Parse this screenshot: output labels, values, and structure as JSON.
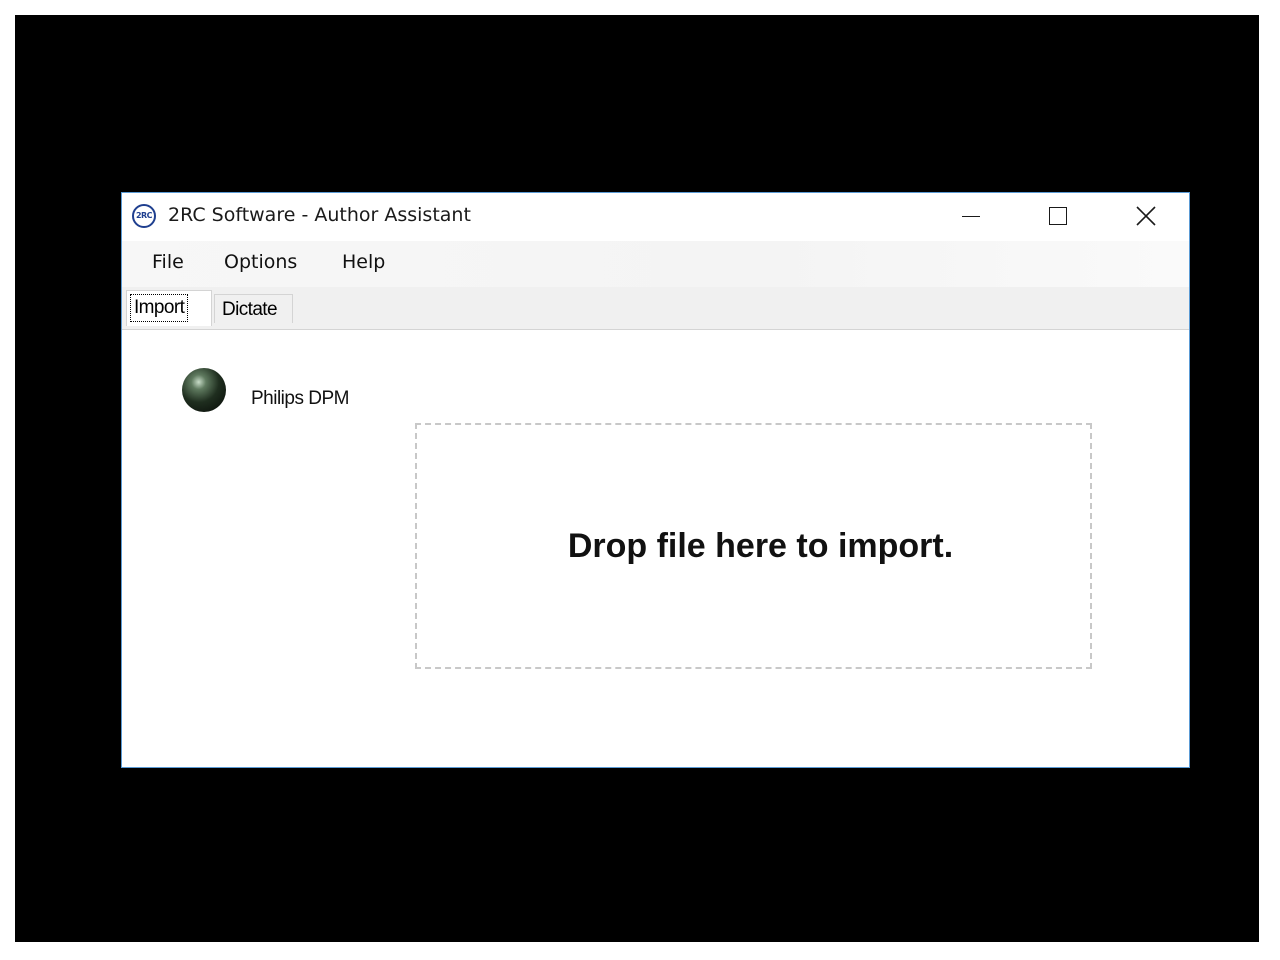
{
  "window": {
    "title": "2RC Software - Author Assistant",
    "app_icon_text": "2RC",
    "icon": "2rc-logo-icon",
    "controls": {
      "minimize_icon": "minimize-icon",
      "maximize_icon": "maximize-icon",
      "close_icon": "close-icon"
    },
    "border_color": "#5b9bd5"
  },
  "menu": {
    "items": [
      {
        "label": "File"
      },
      {
        "label": "Options"
      },
      {
        "label": "Help"
      }
    ]
  },
  "tabs": [
    {
      "label": "Import",
      "selected": true
    },
    {
      "label": "Dictate",
      "selected": false
    }
  ],
  "import_panel": {
    "device": {
      "status_icon": "status-led-icon",
      "status_color": "#1f2e1f",
      "label": "Philips DPM"
    },
    "dropzone": {
      "text": "Drop file here to import."
    }
  }
}
